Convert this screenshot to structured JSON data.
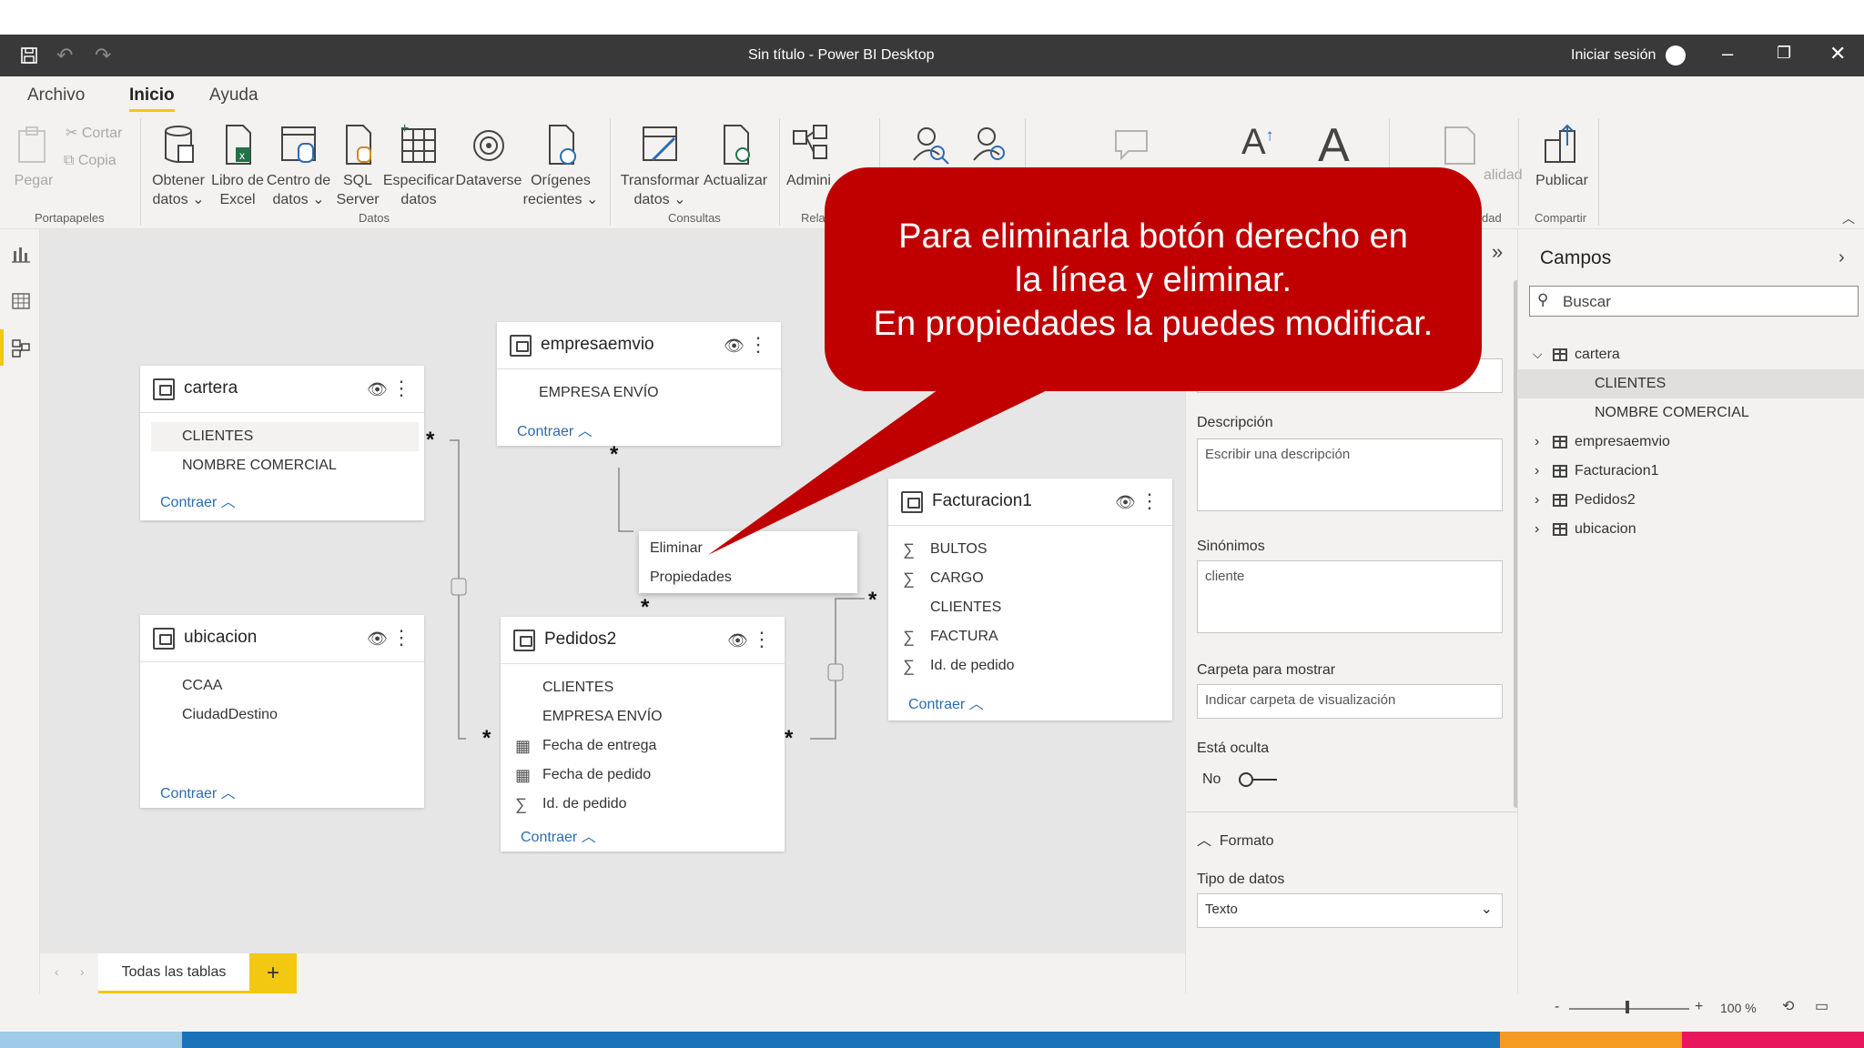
{
  "window": {
    "title": "Sin título - Power BI Desktop",
    "signin_label": "Iniciar sesión"
  },
  "ribbon": {
    "tabs": [
      {
        "label": "Archivo"
      },
      {
        "label": "Inicio"
      },
      {
        "label": "Ayuda"
      }
    ],
    "clipboard": {
      "paste": "Pegar",
      "cut": "Cortar",
      "copy": "Copia",
      "group": "Portapapeles"
    },
    "data_buttons": [
      {
        "label": "Obtener datos ⌄"
      },
      {
        "label": "Libro de Excel"
      },
      {
        "label": "Centro de datos ⌄"
      },
      {
        "label": "SQL Server"
      },
      {
        "label": "Especificar datos"
      },
      {
        "label": "Dataverse"
      },
      {
        "label": "Orígenes recientes ⌄"
      }
    ],
    "data_group": "Datos",
    "query_buttons": [
      {
        "label": "Transformar datos ⌄"
      },
      {
        "label": "Actualizar"
      }
    ],
    "query_group": "Consultas",
    "relations_button": "Admini relac",
    "relations_group": "Rela",
    "hidden_label_fragment": "alidad",
    "hidden_group_fragment": "dad",
    "publish_button": "Publicar",
    "share_group": "Compartir"
  },
  "model": {
    "tables": [
      {
        "name": "cartera",
        "fields": [
          "CLIENTES",
          "NOMBRE COMERCIAL"
        ],
        "collapse": "Contraer"
      },
      {
        "name": "empresaemvio",
        "fields": [
          "EMPRESA ENVÍO"
        ],
        "collapse": "Contraer"
      },
      {
        "name": "ubicacion",
        "fields": [
          "CCAA",
          "CiudadDestino"
        ],
        "collapse": "Contraer"
      },
      {
        "name": "Pedidos2",
        "fields": [
          "CLIENTES",
          "EMPRESA ENVÍO",
          "Fecha de entrega",
          "Fecha de pedido",
          "Id. de pedido"
        ],
        "collapse": "Contraer"
      },
      {
        "name": "Facturacion1",
        "fields": [
          "BULTOS",
          "CARGO",
          "CLIENTES",
          "FACTURA",
          "Id. de pedido"
        ],
        "collapse": "Contraer"
      }
    ],
    "context_menu": [
      "Eliminar",
      "Propiedades"
    ],
    "bottom_tab": "Todas las tablas",
    "add_tab": "+"
  },
  "callout": {
    "lines": [
      "Para eliminarla botón derecho en",
      "la línea y eliminar.",
      "En propiedades la puedes modificar."
    ],
    "color": "#c00000"
  },
  "properties": {
    "description_label": "Descripción",
    "description_placeholder": "Escribir una descripción",
    "synonyms_label": "Sinónimos",
    "synonyms_value": "cliente",
    "folder_label": "Carpeta para mostrar",
    "folder_placeholder": "Indicar carpeta de visualización",
    "hidden_label": "Está oculta",
    "hidden_value": "No",
    "format_section": "Formato",
    "datatype_label": "Tipo de datos",
    "datatype_value": "Texto"
  },
  "fields_pane": {
    "title": "Campos",
    "search_placeholder": "Buscar",
    "tree": [
      {
        "label": "cartera",
        "expanded": true
      },
      {
        "label": "CLIENTES",
        "child": true,
        "selected": true
      },
      {
        "label": "NOMBRE COMERCIAL",
        "child": true
      },
      {
        "label": "empresaemvio"
      },
      {
        "label": "Facturacion1"
      },
      {
        "label": "Pedidos2"
      },
      {
        "label": "ubicacion"
      }
    ]
  },
  "status": {
    "zoom": "100 %"
  },
  "colors": {
    "titlebar": "#393939",
    "accent": "#f2c811",
    "link": "#2b6cb0"
  }
}
